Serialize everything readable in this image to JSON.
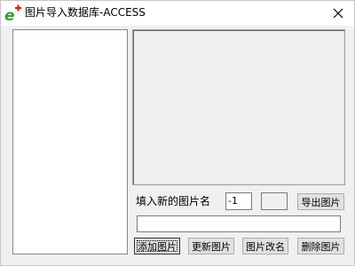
{
  "window": {
    "title": "图片导入数据库-ACCESS",
    "app_icon": "e-plus-icon",
    "close_icon": "close-icon"
  },
  "form": {
    "name_label": "填入新的图片名",
    "id_value": "-1",
    "blank_value": "",
    "path_value": ""
  },
  "buttons": {
    "export": "导出图片",
    "add": "添加图片",
    "update": "更新图片",
    "rename": "图片改名",
    "delete": "删除图片"
  }
}
